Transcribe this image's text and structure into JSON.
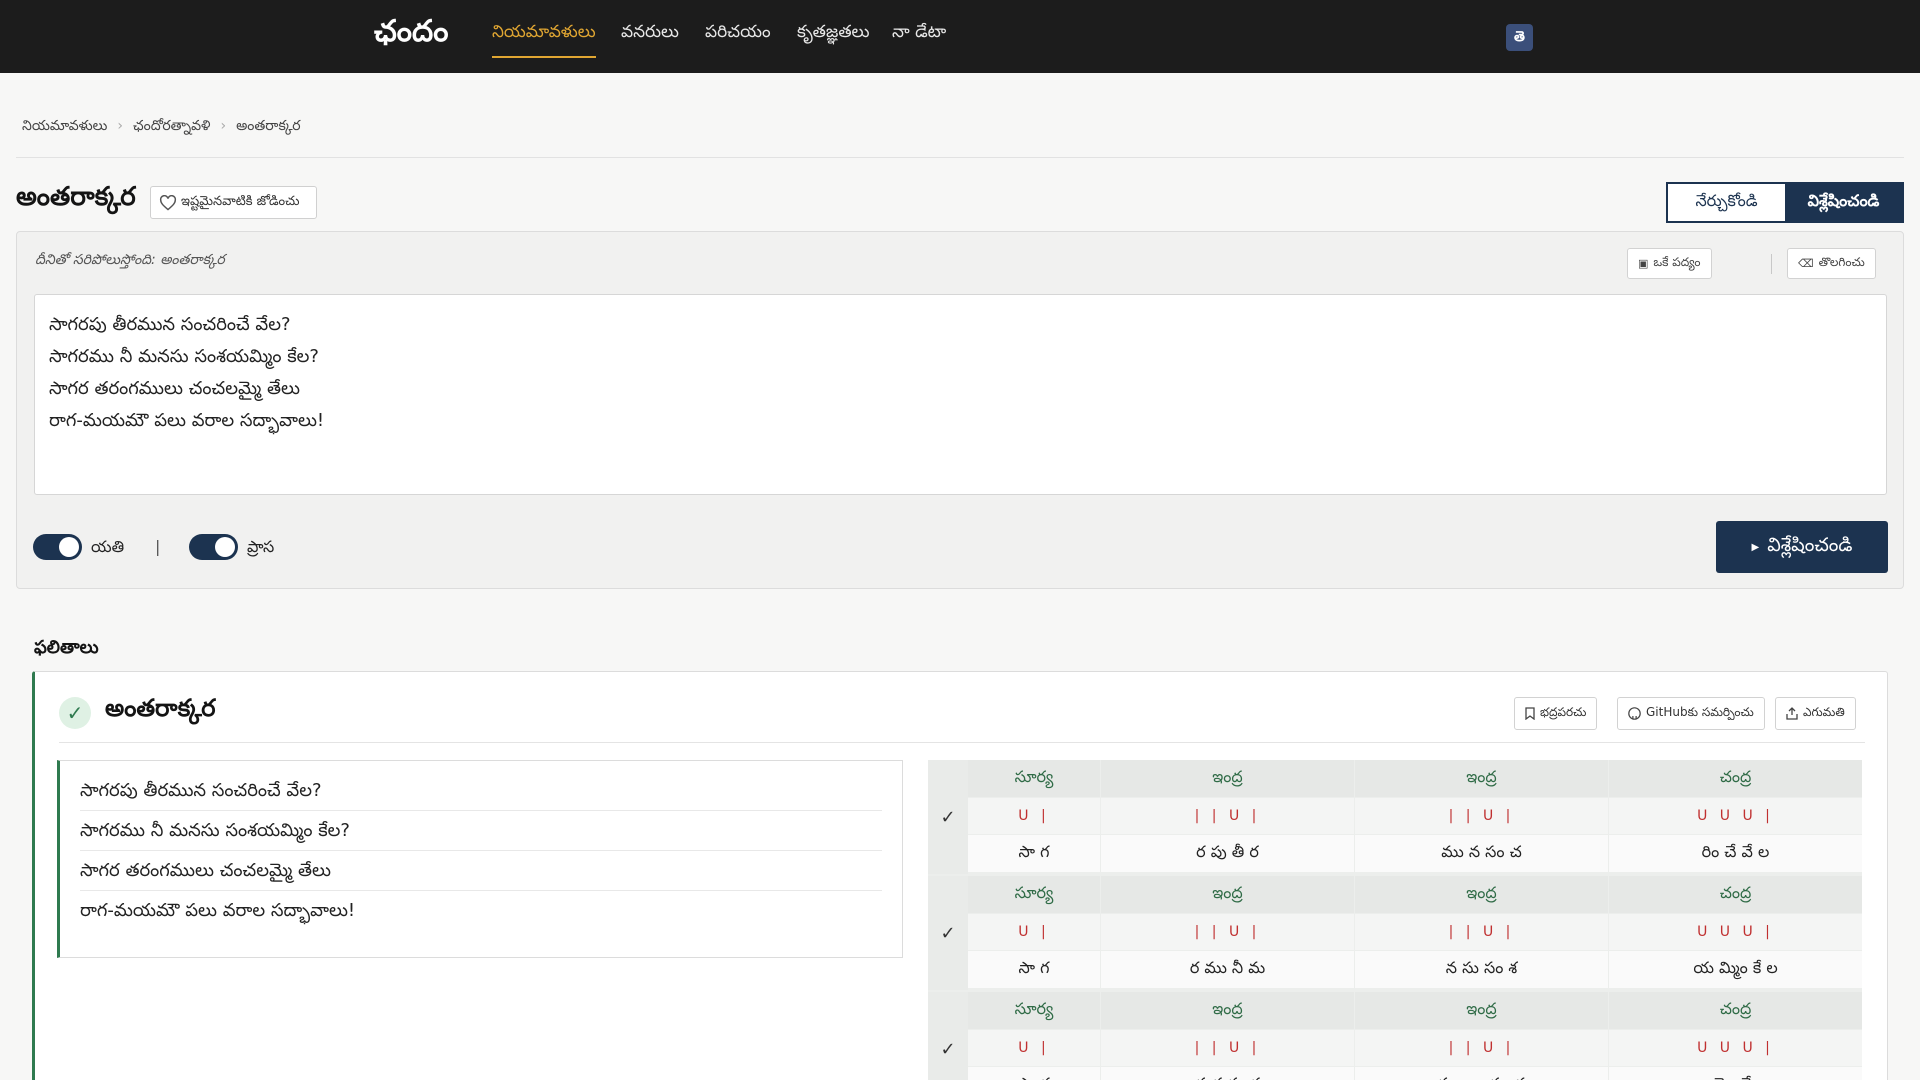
{
  "nav": {
    "brand": "ఛందం",
    "items": [
      "నియమావళులు",
      "వనరులు",
      "పరిచయం",
      "కృతజ్ఞతలు",
      "నా డేటా"
    ],
    "lang_button": "తె"
  },
  "breadcrumb": [
    "నియమావళులు",
    "ఛందోరత్నావళి",
    "అంతరాక్కర"
  ],
  "page": {
    "title": "అంతరాక్కర",
    "favorite_label": "ఇష్టమైనవాటికి జోడించు",
    "mode_learn": "నేర్చుకోండి",
    "mode_analyze": "విశ్లేషించండి"
  },
  "input": {
    "match_text": "దీనితో సరిపోలుస్తోంది: అంతరాక్కర",
    "tool_one_line": "ఒకే పద్యం",
    "tool_clear": "తొలగించు",
    "poem": "సాగరపు తీరమున సంచరించే వేల?\nసాగరము నీ మనసు సంశయమ్మిం కేల?\nసాగర తరంగములు చంచలమ్మై తేలు\nరాగ-మయమౌ పలు వరాల సద్భావాలు!",
    "yati_label": "యతి",
    "prasa_label": "ప్రాస",
    "separator": "|",
    "analyze_label": "విశ్లేషించండి"
  },
  "results": {
    "heading": "ఫలితాలు",
    "title": "అంతరాక్కర",
    "btn_save": "భద్రపరచు",
    "btn_github": "GitHubకు సమర్పించు",
    "btn_export": "ఎగుమతి",
    "lines": [
      "సాగరపు తీరమున సంచరించే వేల?",
      "సాగరము నీ మనసు సంశయమ్మిం కేల?",
      "సాగర తరంగములు చంచలమ్మై తేలు",
      "రాగ-మయమౌ పలు వరాల సద్భావాలు!"
    ],
    "grid": [
      {
        "check": "✓",
        "names": [
          "సూర్య",
          "ఇంద్ర",
          "ఇంద్ర",
          "చంద్ర"
        ],
        "marks": [
          "U |",
          "| | U |",
          "| | U |",
          "U U U |"
        ],
        "syllables": [
          "సా గ",
          "ర పు తీ ర",
          "ము న సం చ",
          "రిం చే వే ల"
        ]
      },
      {
        "check": "✓",
        "names": [
          "సూర్య",
          "ఇంద్ర",
          "ఇంద్ర",
          "చంద్ర"
        ],
        "marks": [
          "U |",
          "| | U |",
          "| | U |",
          "U U U |"
        ],
        "syllables": [
          "సా గ",
          "ర ము నీ మ",
          "న సు సం శ",
          "య మ్మిం కే ల"
        ]
      },
      {
        "check": "✓",
        "names": [
          "సూర్య",
          "ఇంద్ర",
          "ఇంద్ర",
          "చంద్ర"
        ],
        "marks": [
          "U |",
          "| | U |",
          "| | U |",
          "U U U |"
        ],
        "syllables": [
          "సా గ",
          "ర త రం గ",
          "ము లు చం చ",
          "ల మ్మై తే లు"
        ]
      }
    ]
  },
  "colors": {
    "nav_bg": "#1c1c1c",
    "accent": "#e0a632",
    "primary": "#1c3350",
    "success": "#2f7a4f",
    "mark_red": "#c03030"
  }
}
